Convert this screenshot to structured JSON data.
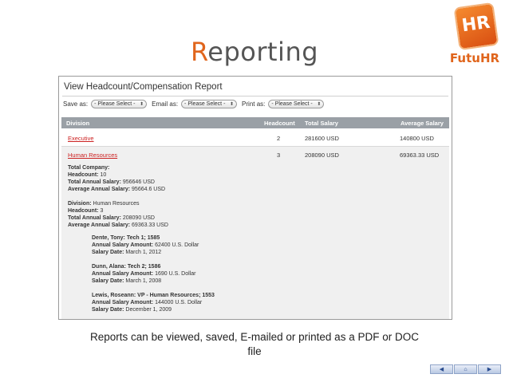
{
  "slide": {
    "title_first": "R",
    "title_rest": "eporting",
    "caption_line1": "Reports can be viewed, saved, E-mailed or printed as a PDF or DOC",
    "caption_line2": "file"
  },
  "logo": {
    "badge_text": "HR",
    "brand_text": "FutuHR"
  },
  "report": {
    "title": "View Headcount/Compensation Report",
    "save_label": "Save as:",
    "email_label": "Email as:",
    "print_label": "Print as:",
    "select_placeholder": "- Please Select -",
    "columns": [
      "Division",
      "Headcount",
      "Total Salary",
      "Average Salary"
    ],
    "rows": [
      {
        "division": "Executive",
        "headcount": "2",
        "total": "281600 USD",
        "average": "140800 USD"
      },
      {
        "division": "Human Resources",
        "headcount": "3",
        "total": "208090 USD",
        "average": "69363.33 USD"
      }
    ],
    "company": {
      "heading": "Total Company:",
      "headcount_label": "Headcount:",
      "headcount_value": "10",
      "total_label": "Total Annual Salary:",
      "total_value": "956646 USD",
      "avg_label": "Average Annual Salary:",
      "avg_value": "95664.6 USD"
    },
    "division": {
      "division_label": "Division:",
      "division_value": "Human Resources",
      "headcount_label": "Headcount:",
      "headcount_value": "3",
      "total_label": "Total Annual Salary:",
      "total_value": "208090 USD",
      "avg_label": "Average Annual Salary:",
      "avg_value": "69363.33 USD"
    },
    "employees": [
      {
        "name": "Dente, Tony: Tech 1; 1585",
        "amount_label": "Annual Salary Amount:",
        "amount": "62400 U.S. Dollar",
        "date_label": "Salary Date:",
        "date": "March 1, 2012"
      },
      {
        "name": "Dunn, Alana: Tech 2; 1586",
        "amount_label": "Annual Salary Amount:",
        "amount": "1690 U.S. Dollar",
        "date_label": "Salary Date:",
        "date": "March 1, 2008"
      },
      {
        "name": "Lewis, Roseann: VP - Human Resources; 1553",
        "amount_label": "Annual Salary Amount:",
        "amount": "144000 U.S. Dollar",
        "date_label": "Salary Date:",
        "date": "December 1, 2009"
      }
    ]
  },
  "nav": {
    "prev_icon": "◀",
    "home_icon": "⌂",
    "next_icon": "▶"
  }
}
